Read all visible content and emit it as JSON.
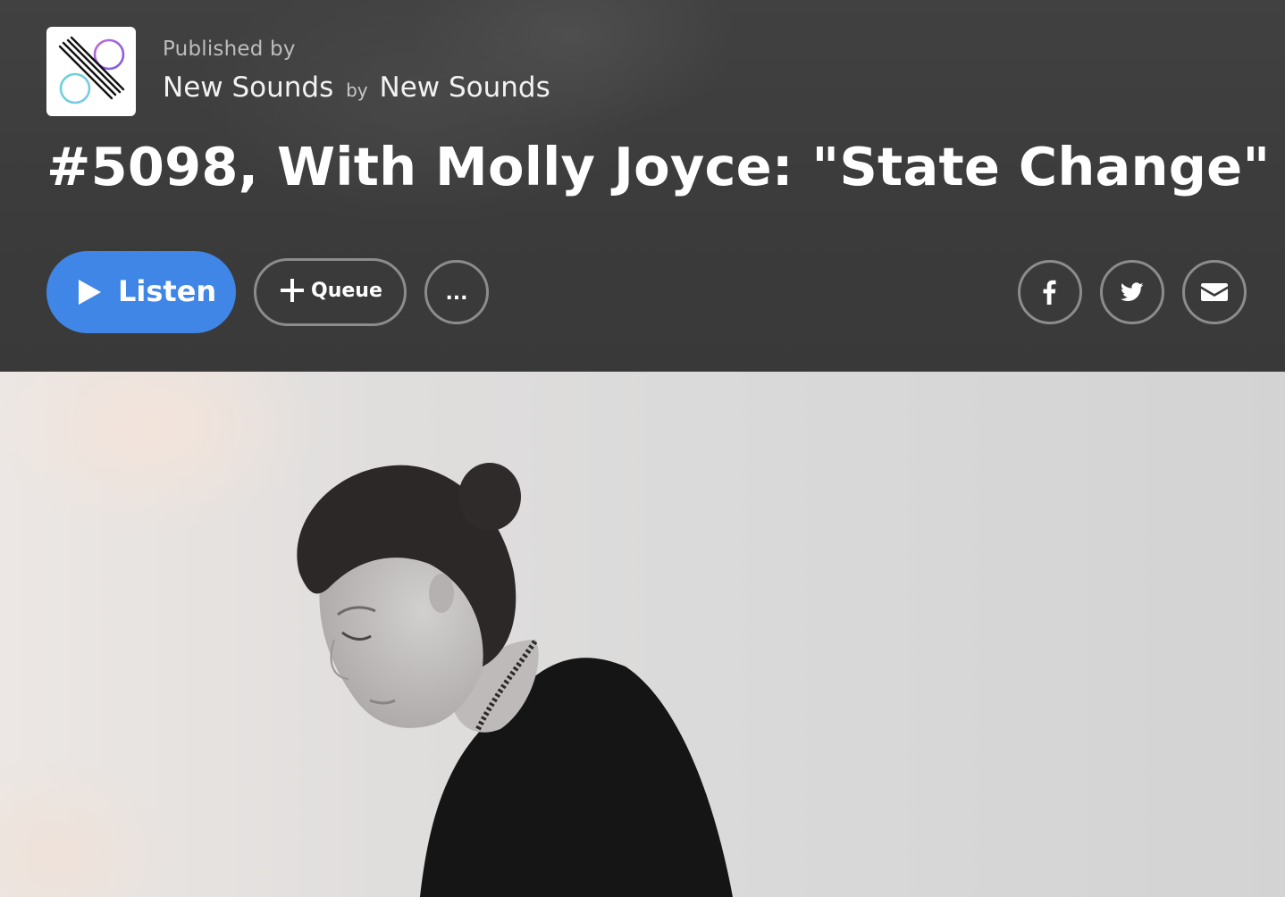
{
  "header": {
    "published_by_label": "Published by",
    "show_name": "New Sounds",
    "by_word": "by",
    "publisher_name": "New Sounds",
    "episode_title": "#5098, With Molly Joyce: \"State Change\""
  },
  "actions": {
    "listen_label": "Listen",
    "queue_label": "Queue",
    "more_label": "..."
  },
  "share": {
    "icons": [
      "facebook-icon",
      "twitter-icon",
      "email-icon"
    ]
  },
  "colors": {
    "header_background": "#3b3b3b",
    "listen_button": "#3f86e6",
    "outline_button_border": "#8c8c8c",
    "logo_purple": "#9b59d6",
    "logo_teal": "#5bd3cf"
  }
}
